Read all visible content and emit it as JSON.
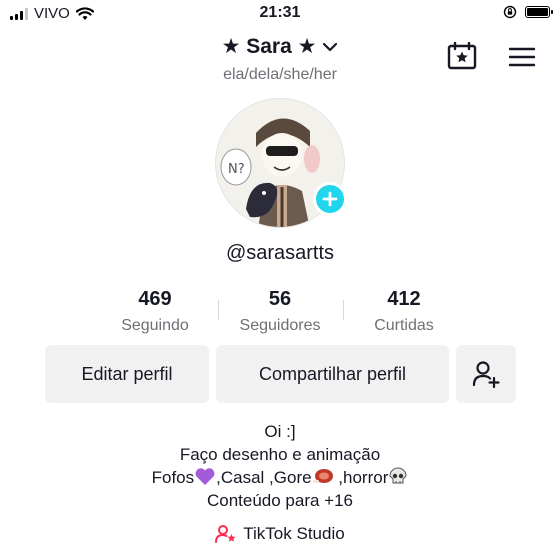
{
  "status_bar": {
    "carrier": "VIVO",
    "time": "21:31",
    "battery_level": 1.0,
    "icons": [
      "signal-icon",
      "wifi-icon",
      "orientation-lock-icon",
      "battery-icon"
    ]
  },
  "header": {
    "display_name": "★ Sara ★",
    "pronouns": "ela/dela/she/her",
    "icons": [
      "chevron-down-icon",
      "calendar-star-icon",
      "menu-icon"
    ]
  },
  "profile": {
    "username": "@sarasartts",
    "avatar_icon": "avatar-illustration",
    "add_icon": "plus-icon"
  },
  "stats": [
    {
      "value": "469",
      "label": "Seguindo"
    },
    {
      "value": "56",
      "label": "Seguidores"
    },
    {
      "value": "412",
      "label": "Curtidas"
    }
  ],
  "actions": {
    "edit": "Editar perfil",
    "share": "Compartilhar perfil",
    "add_friend_icon": "add-user-icon"
  },
  "bio": {
    "line1": "Oi :]",
    "line2": "Faço desenho e animação",
    "line3_a": "Fofos",
    "line3_b": ",Casal ,Gore",
    "line3_c": " ,horror",
    "line4": "Conteúdo para +16",
    "emojis": [
      "purple-heart-icon",
      "meat-icon",
      "skull-icon"
    ]
  },
  "studio": {
    "label": "TikTok Studio",
    "icon": "studio-user-star-icon"
  },
  "colors": {
    "accent": "#20d5ec",
    "text": "#161823",
    "secondary": "#6f7075",
    "button_bg": "#f1f1f2",
    "studio_icon": "#fe2c55"
  }
}
